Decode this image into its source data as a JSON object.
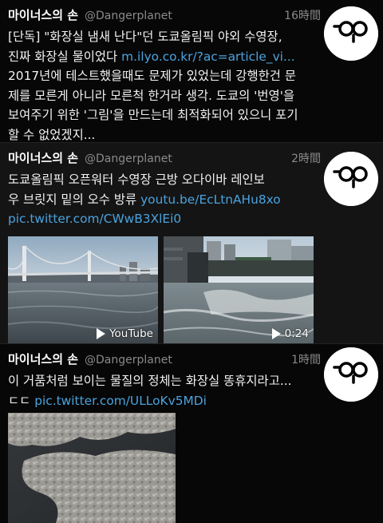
{
  "tweets": [
    {
      "name": "마이너스의 손",
      "handle": "@Dangerplanet",
      "time": "16時間",
      "lines": [
        "[단독] \"화장실 냄새 난다\"던 도쿄올림픽 야외 수영장,",
        "진짜 화장실 물이었다",
        "2017년에 테스트했을때도 문제가 있었는데 강행한건 문",
        "제를 모른게 아니라 모른척 한거라 생각. 도쿄의 '번영'을",
        "보여주기 위한 '그림'을 만드는데 최적화되어 있으니 포기",
        "할 수 없었겠지..."
      ],
      "link": "m.ilyo.co.kr/?ac=article_vi..."
    },
    {
      "name": "마이너스의 손",
      "handle": "@Dangerplanet",
      "time": "2時間",
      "lines": [
        "도쿄올림픽 오픈워터 수영장 근방 오다이바 레인보",
        "우 브릿지 밑의 오수 방류"
      ],
      "link_youtube": "youtu.be/EcLtnAHu8xo",
      "link_pic": "pic.twitter.com/CWwB3XlEi0",
      "media": [
        {
          "label": "YouTube",
          "icon": "play-icon"
        },
        {
          "label": "0:24",
          "icon": "play-icon"
        }
      ]
    },
    {
      "name": "마이너스의 손",
      "handle": "@Dangerplanet",
      "time": "1時間",
      "lines": [
        "이 거품처럼 보이는 물질의 정체는 화장실 똥휴지라고...",
        "ㄷㄷ"
      ],
      "link_pic": "pic.twitter.com/ULLoKv5MDi"
    }
  ],
  "avatar_icon": "glasses-face-icon",
  "colors": {
    "link": "#4aa3df",
    "muted": "#8a8a8a",
    "background": "#000000"
  }
}
